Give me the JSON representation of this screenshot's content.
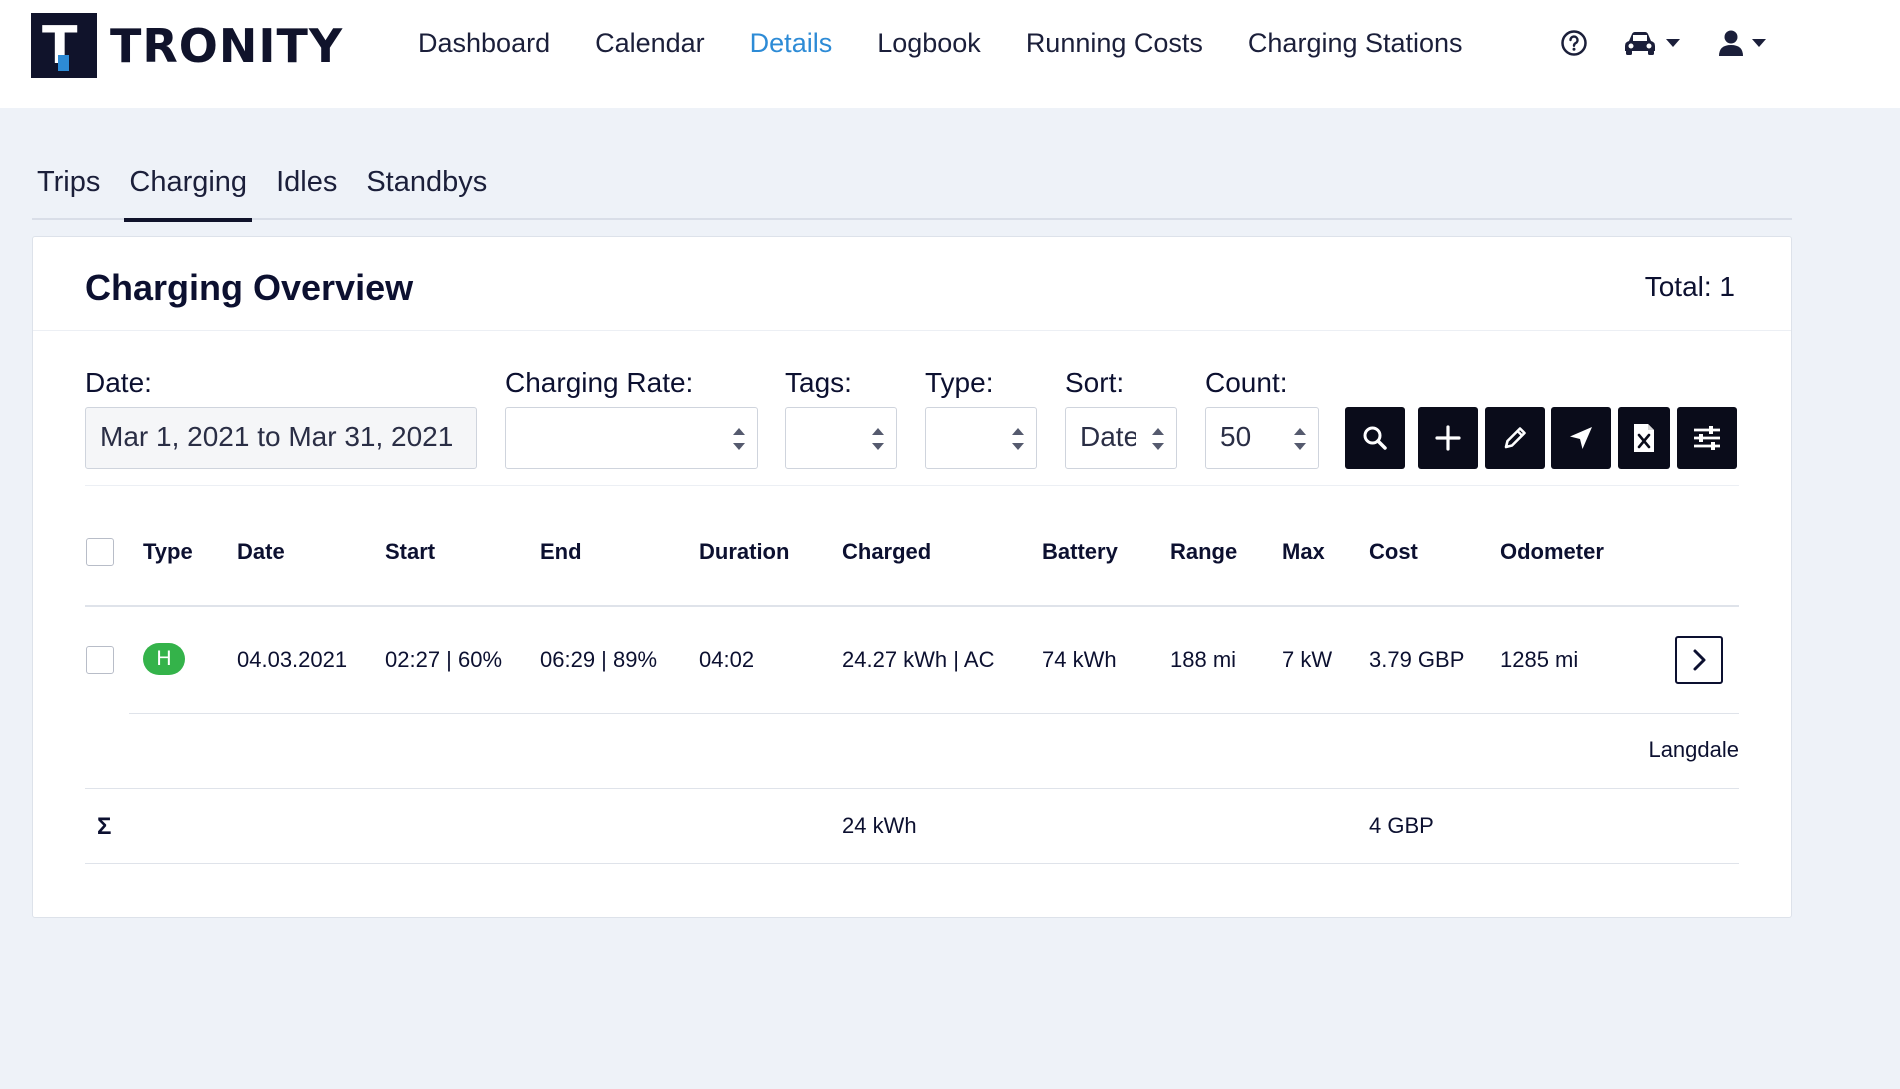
{
  "brand": {
    "name": "TRONITY",
    "logo_letter": "T"
  },
  "nav": {
    "items": [
      "Dashboard",
      "Calendar",
      "Details",
      "Logbook",
      "Running Costs",
      "Charging Stations"
    ],
    "active": "Details",
    "icons": [
      "help-circle-icon",
      "car-icon",
      "user-icon"
    ]
  },
  "tabs": [
    "Trips",
    "Charging",
    "Idles",
    "Standbys"
  ],
  "active_tab": "Charging",
  "card": {
    "title": "Charging Overview",
    "total": "Total: 1"
  },
  "filters": {
    "date": {
      "label": "Date:",
      "value": "Mar 1, 2021 to Mar 31, 2021"
    },
    "charging_rate": {
      "label": "Charging Rate:",
      "value": ""
    },
    "tags": {
      "label": "Tags:",
      "value": ""
    },
    "type": {
      "label": "Type:",
      "value": ""
    },
    "sort": {
      "label": "Sort:",
      "value": "Date"
    },
    "count": {
      "label": "Count:",
      "value": "50"
    }
  },
  "actions": [
    "search-icon",
    "plus-icon",
    "pencil-icon",
    "location-arrow-icon",
    "excel-file-icon",
    "sliders-icon"
  ],
  "table": {
    "columns": [
      "Type",
      "Date",
      "Start",
      "End",
      "Duration",
      "Charged",
      "Battery",
      "Range",
      "Max",
      "Cost",
      "Odometer"
    ],
    "rows": [
      {
        "type": "H",
        "date": "04.03.2021",
        "start": "02:27 | 60%",
        "end": "06:29 | 89%",
        "duration": "04:02",
        "charged": "24.27 kWh | AC",
        "battery": "74 kWh",
        "range": "188 mi",
        "max": "7 kW",
        "cost": "3.79 GBP",
        "odometer": "1285 mi",
        "location": "Langdale"
      }
    ],
    "totals": {
      "symbol": "Σ",
      "charged": "24 kWh",
      "cost": "4 GBP"
    }
  },
  "colors": {
    "accent": "#2d8bd6",
    "badge_green": "#34b34a",
    "dark": "#0a0c1a",
    "background": "#eef2f8"
  }
}
